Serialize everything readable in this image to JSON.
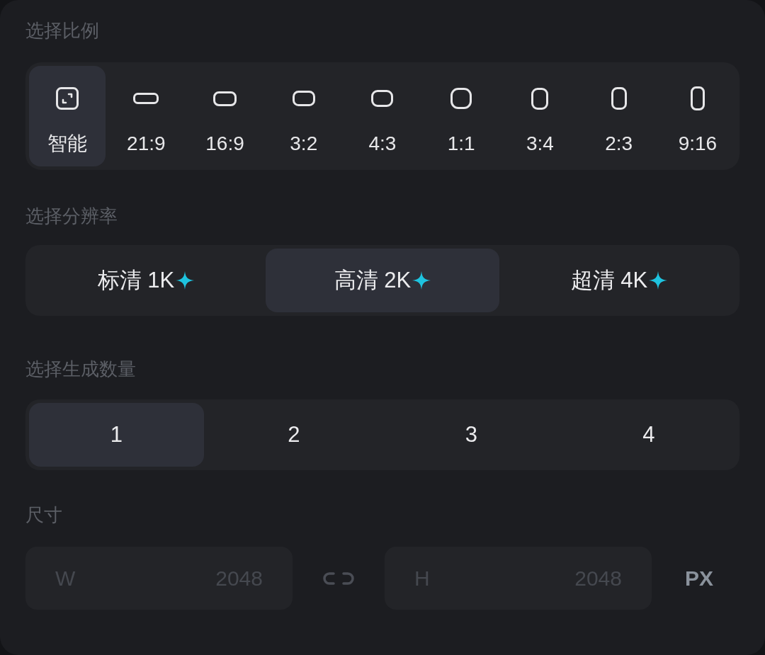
{
  "ratio": {
    "label": "选择比例",
    "options": [
      {
        "label": "智能",
        "kind": "smart",
        "selected": true
      },
      {
        "label": "21:9",
        "kind": "shape",
        "selected": false
      },
      {
        "label": "16:9",
        "kind": "shape",
        "selected": false
      },
      {
        "label": "3:2",
        "kind": "shape",
        "selected": false
      },
      {
        "label": "4:3",
        "kind": "shape",
        "selected": false
      },
      {
        "label": "1:1",
        "kind": "shape",
        "selected": false
      },
      {
        "label": "3:4",
        "kind": "shape",
        "selected": false
      },
      {
        "label": "2:3",
        "kind": "shape",
        "selected": false
      },
      {
        "label": "9:16",
        "kind": "shape",
        "selected": false
      }
    ]
  },
  "resolution": {
    "label": "选择分辨率",
    "options": [
      {
        "label": "标清 1K",
        "selected": false
      },
      {
        "label": "高清 2K",
        "selected": true
      },
      {
        "label": "超清 4K",
        "selected": false
      }
    ]
  },
  "count": {
    "label": "选择生成数量",
    "options": [
      {
        "label": "1",
        "selected": true
      },
      {
        "label": "2",
        "selected": false
      },
      {
        "label": "3",
        "selected": false
      },
      {
        "label": "4",
        "selected": false
      }
    ]
  },
  "size": {
    "label": "尺寸",
    "width": {
      "prefix": "W",
      "value": "2048",
      "disabled": true
    },
    "height": {
      "prefix": "H",
      "value": "2048",
      "disabled": true
    },
    "unit": "PX"
  }
}
